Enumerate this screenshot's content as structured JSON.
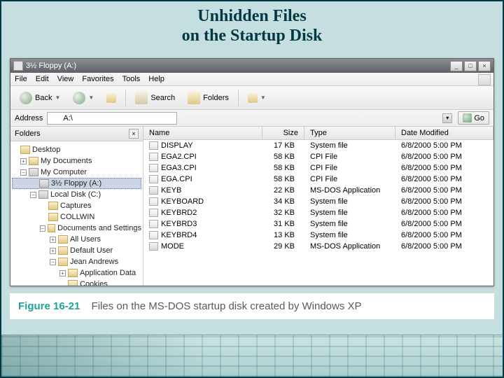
{
  "slide": {
    "title_line1": "Unhidden Files",
    "title_line2": "on the Startup Disk"
  },
  "window": {
    "title": "3½ Floppy (A:)"
  },
  "menu": {
    "file": "File",
    "edit": "Edit",
    "view": "View",
    "favorites": "Favorites",
    "tools": "Tools",
    "help": "Help"
  },
  "toolbar": {
    "back": "Back",
    "search": "Search",
    "folders": "Folders"
  },
  "address": {
    "label": "Address",
    "value": "A:\\",
    "go": "Go"
  },
  "folders_panel": {
    "title": "Folders"
  },
  "tree": {
    "desktop": "Desktop",
    "mydocs": "My Documents",
    "mycomp": "My Computer",
    "floppy": "3½ Floppy (A:)",
    "localdisk": "Local Disk (C:)",
    "captures": "Captures",
    "collwin": "COLLWIN",
    "docset": "Documents and Settings",
    "allusers": "All Users",
    "defaultuser": "Default User",
    "jean": "Jean Andrews",
    "appdata": "Application Data",
    "cookies": "Cookies"
  },
  "columns": {
    "name": "Name",
    "size": "Size",
    "type": "Type",
    "date": "Date Modified"
  },
  "chart_data": {
    "type": "table",
    "columns": [
      "Name",
      "Size",
      "Type",
      "Date Modified"
    ],
    "rows": [
      {
        "name": "DISPLAY",
        "size": "17 KB",
        "type": "System file",
        "date": "6/8/2000 5:00 PM"
      },
      {
        "name": "EGA2.CPI",
        "size": "58 KB",
        "type": "CPI File",
        "date": "6/8/2000 5:00 PM"
      },
      {
        "name": "EGA3.CPI",
        "size": "58 KB",
        "type": "CPI File",
        "date": "6/8/2000 5:00 PM"
      },
      {
        "name": "EGA.CPI",
        "size": "58 KB",
        "type": "CPI File",
        "date": "6/8/2000 5:00 PM"
      },
      {
        "name": "KEYB",
        "size": "22 KB",
        "type": "MS-DOS Application",
        "date": "6/8/2000 5:00 PM"
      },
      {
        "name": "KEYBOARD",
        "size": "34 KB",
        "type": "System file",
        "date": "6/8/2000 5:00 PM"
      },
      {
        "name": "KEYBRD2",
        "size": "32 KB",
        "type": "System file",
        "date": "6/8/2000 5:00 PM"
      },
      {
        "name": "KEYBRD3",
        "size": "31 KB",
        "type": "System file",
        "date": "6/8/2000 5:00 PM"
      },
      {
        "name": "KEYBRD4",
        "size": "13 KB",
        "type": "System file",
        "date": "6/8/2000 5:00 PM"
      },
      {
        "name": "MODE",
        "size": "29 KB",
        "type": "MS-DOS Application",
        "date": "6/8/2000 5:00 PM"
      }
    ]
  },
  "caption": {
    "label": "Figure 16-21",
    "text": "Files on the MS-DOS startup disk created by Windows XP"
  }
}
